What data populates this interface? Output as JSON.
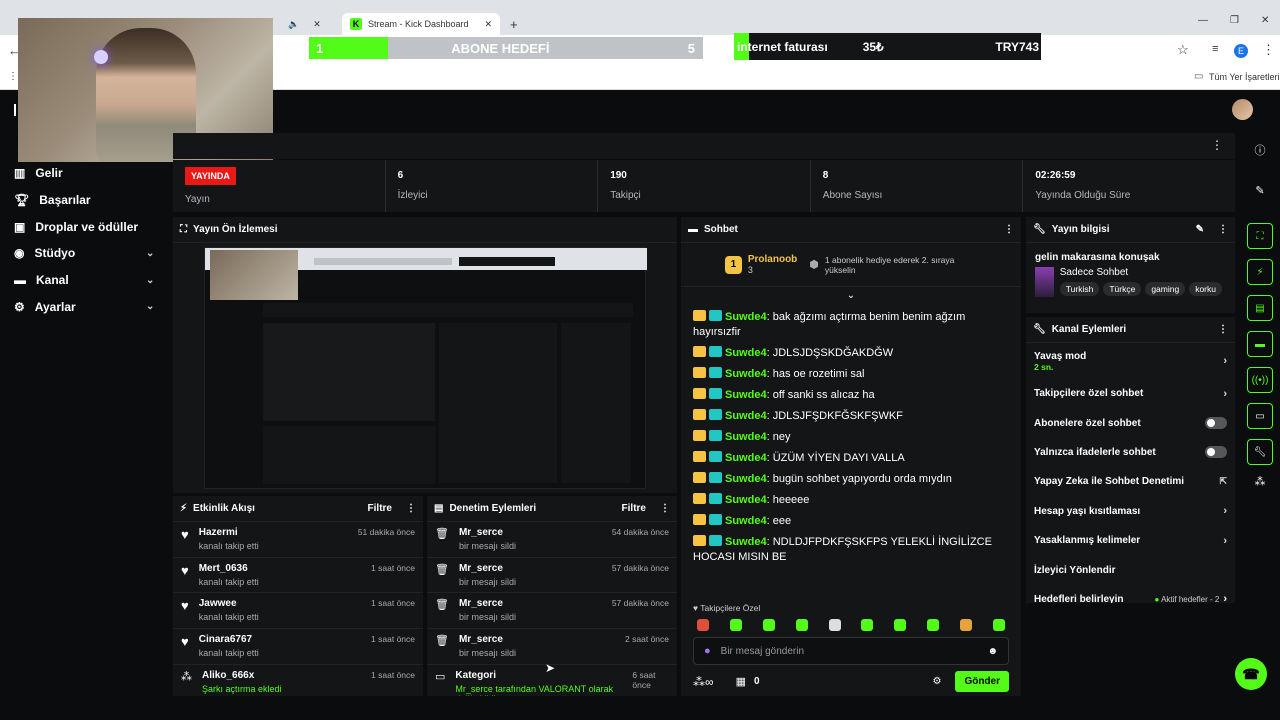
{
  "browser": {
    "tab_prev_label": "",
    "tab_active_label": "Stream - Kick Dashboard",
    "new_tab_icon": "plus-icon",
    "bookmarks_label": "Tüm Yer İşaretleri",
    "profile_initial": "E"
  },
  "overlay": {
    "goal_left_current": "1",
    "goal_left_title": "ABONE HEDEFİ",
    "goal_left_target": "5",
    "goal_left_progress_pct": 20,
    "goal_right_title": "internet faturası",
    "goal_right_amount": "35₺",
    "goal_right_target": "TRY743",
    "goal_right_progress_pct": 5
  },
  "sidebar": {
    "items": [
      {
        "label": "Gelir",
        "icon": "chart-icon",
        "expandable": false
      },
      {
        "label": "Başarılar",
        "icon": "trophy-icon",
        "expandable": false
      },
      {
        "label": "Droplar ve ödüller",
        "icon": "gift-icon",
        "expandable": false
      },
      {
        "label": "Stüdyo",
        "icon": "studio-icon",
        "expandable": true
      },
      {
        "label": "Kanal",
        "icon": "channel-icon",
        "expandable": true
      },
      {
        "label": "Ayarlar",
        "icon": "gear-icon",
        "expandable": true
      }
    ]
  },
  "stats": {
    "live_badge": "YAYINDA",
    "live_label": "Yayın",
    "viewers_value": "6",
    "viewers_label": "İzleyici",
    "followers_value": "190",
    "followers_label": "Takipçi",
    "subs_value": "8",
    "subs_label": "Abone Sayısı",
    "uptime_value": "02:26:59",
    "uptime_label": "Yayında Olduğu Süre"
  },
  "preview": {
    "title": "Yayın Ön İzlemesi"
  },
  "activity": {
    "title": "Etkinlik Akışı",
    "filter": "Filtre",
    "rows": [
      {
        "name": "Hazermi",
        "sub": "kanalı takip etti",
        "time": "51 dakika önce"
      },
      {
        "name": "Mert_0636",
        "sub": "kanalı takip etti",
        "time": "1 saat önce"
      },
      {
        "name": "Jawwee",
        "sub": "kanalı takip etti",
        "time": "1 saat önce"
      },
      {
        "name": "Cinara6767",
        "sub": "kanalı takip etti",
        "time": "1 saat önce"
      },
      {
        "name": "Aliko_666x",
        "sub": "Şarkı açtırma ekledi",
        "time": "1 saat önce"
      }
    ]
  },
  "moderation": {
    "title": "Denetim Eylemleri",
    "filter": "Filtre",
    "rows": [
      {
        "name": "Mr_serce",
        "sub": "bir mesajı sildi",
        "time": "54 dakika önce"
      },
      {
        "name": "Mr_serce",
        "sub": "bir mesajı sildi",
        "time": "57 dakika önce"
      },
      {
        "name": "Mr_serce",
        "sub": "bir mesajı sildi",
        "time": "57 dakika önce"
      },
      {
        "name": "Mr_serce",
        "sub": "bir mesajı sildi",
        "time": "2 saat önce"
      },
      {
        "name": "Kategori",
        "sub": "Mr_serce tarafından VALORANT olarak değiştirildi",
        "time": "6 saat önce"
      }
    ]
  },
  "chat": {
    "title": "Sohbet",
    "pinned_user": "Prolanoob",
    "pinned_count": "3",
    "pinned_rank": "1",
    "pinned_text": "1 abonelik hediye ederek 2. sıraya yükselin",
    "messages": [
      {
        "user": "Suwde4",
        "text": "bak ağzımı açtırma benim benim ağzım hayırsızfir"
      },
      {
        "user": "Suwde4",
        "text": "JDLSJDŞSKDĞAKDĞW"
      },
      {
        "user": "Suwde4",
        "text": "has oe rozetimi sal"
      },
      {
        "user": "Suwde4",
        "text": "off sanki ss alıcaz ha"
      },
      {
        "user": "Suwde4",
        "text": "JDLSJFŞDKFĞSKFŞWKF"
      },
      {
        "user": "Suwde4",
        "text": "ney"
      },
      {
        "user": "Suwde4",
        "text": "ÜZÜM YİYEN DAYI VALLA"
      },
      {
        "user": "Suwde4",
        "text": "bugün sohbet yapıyordu orda mıydın"
      },
      {
        "user": "Suwde4",
        "text": "heeeee"
      },
      {
        "user": "Suwde4",
        "text": "eee"
      },
      {
        "user": "Suwde4",
        "text": "NDLDJFPDKFŞSKFPS YELEKLİ İNGİLİZCE HOCASI MISIN BE"
      }
    ],
    "emote_section": "Takipçilere Özel",
    "input_placeholder": "Bir mesaj gönderin",
    "kicks_count": "0",
    "send_label": "Gönder"
  },
  "stream_info": {
    "title": "Yayın bilgisi",
    "stream_title": "gelin makarasına konuşak",
    "category": "Sadece Sohbet",
    "tags": [
      "Turkish",
      "Türkçe",
      "gaming",
      "korku"
    ]
  },
  "channel_actions": {
    "title": "Kanal Eylemleri",
    "slow_mode": "Yavaş mod",
    "slow_mode_value": "2 sn.",
    "rows": [
      {
        "label": "Takipçilere özel sohbet",
        "control": "chevron"
      },
      {
        "label": "Abonelere özel sohbet",
        "control": "toggle"
      },
      {
        "label": "Yalnızca ifadelerle sohbet",
        "control": "toggle"
      },
      {
        "label": "Yapay Zeka ile Sohbet Denetimi",
        "control": "external"
      },
      {
        "label": "Hesap yaşı kısıtlaması",
        "control": "chevron"
      },
      {
        "label": "Yasaklanmış kelimeler",
        "control": "chevron"
      },
      {
        "label": "İzleyici Yönlendir",
        "control": "none"
      }
    ],
    "goals_label": "Hedefleri belirleyin",
    "goals_status": "Aktif hedefler - 2"
  },
  "colors": {
    "accent": "#53fc18",
    "live": "#e91916",
    "panel": "#141517",
    "bg": "#0b0c0d"
  }
}
